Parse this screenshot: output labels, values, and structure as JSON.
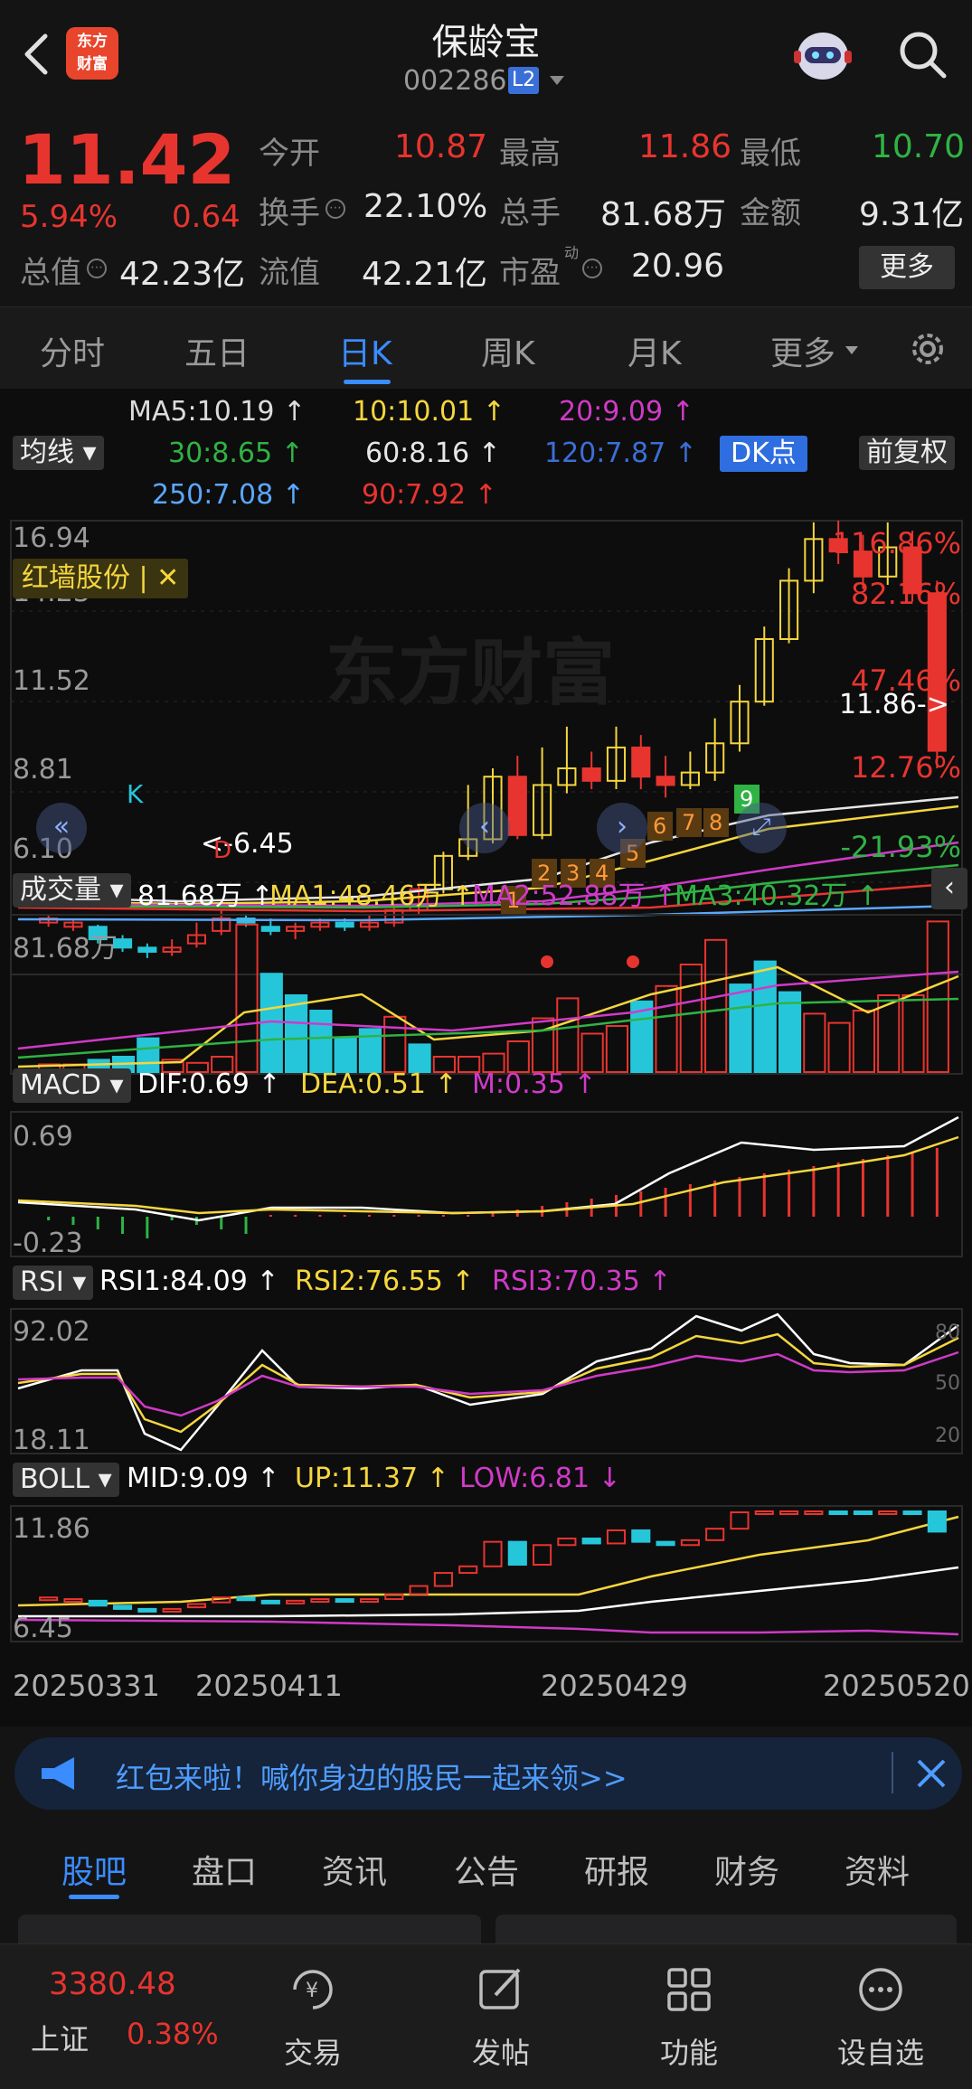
{
  "header": {
    "back_icon": "chevron-left-icon",
    "logo_line1": "东方",
    "logo_line2": "财富",
    "stock_name": "保龄宝",
    "stock_code": "002286",
    "level_badge": "L2",
    "avatar_icon": "robot-avatar-icon",
    "search_icon": "search-icon"
  },
  "quote": {
    "price": "11.42",
    "change_pct": "5.94%",
    "change_amt": "0.64",
    "row1": [
      {
        "label": "今开",
        "value": "10.87",
        "color": "#e8342f"
      },
      {
        "label": "最高",
        "value": "11.86",
        "color": "#e8342f"
      },
      {
        "label": "最低",
        "value": "10.70",
        "color": "#2fb344"
      }
    ],
    "row2": [
      {
        "label": "换手",
        "value": "22.10%"
      },
      {
        "label": "总手",
        "value": "81.68万"
      },
      {
        "label": "金额",
        "value": "9.31亿"
      }
    ],
    "row3": [
      {
        "label": "总值",
        "value": "42.23亿"
      },
      {
        "label": "流值",
        "value": "42.21亿"
      },
      {
        "label": "市盈",
        "value": "20.96"
      }
    ],
    "pe_superscript": "动",
    "more_button": "更多"
  },
  "tabs": [
    "分时",
    "五日",
    "日K",
    "周K",
    "月K",
    "更多"
  ],
  "active_tab": "日K",
  "ma_legend": {
    "button": "均线",
    "items": [
      {
        "text": "MA5:10.19 ↑",
        "color": "#e6e6e6"
      },
      {
        "text": "10:10.01 ↑",
        "color": "#f5d63d"
      },
      {
        "text": "20:9.09 ↑",
        "color": "#d03ac8"
      },
      {
        "text": "30:8.65 ↑",
        "color": "#2fb344"
      },
      {
        "text": "60:8.16 ↑",
        "color": "#e6e6e6"
      },
      {
        "text": "120:7.87 ↑",
        "color": "#3a6fd8"
      },
      {
        "text": "250:7.08 ↑",
        "color": "#5aa8ff"
      },
      {
        "text": "90:7.92 ↑",
        "color": "#e8342f"
      }
    ],
    "dk_button": "DK点",
    "adjust_button": "前复权"
  },
  "kline": {
    "y_labels": [
      "16.94",
      "14.23",
      "11.52",
      "8.81",
      "6.10"
    ],
    "right_pcts": [
      {
        "text": "116.86%",
        "color": "#e8342f"
      },
      {
        "text": "82.16%",
        "color": "#e8342f"
      },
      {
        "text": "47.46%",
        "color": "#e8342f"
      },
      {
        "text": "12.76%",
        "color": "#e8342f"
      },
      {
        "text": "-21.93%",
        "color": "#2fb344"
      }
    ],
    "related_tag": "红墙股份 | ✕",
    "max_marker": "11.86->",
    "min_marker": "<-6.45",
    "k_marker": "K",
    "d_marker": "D",
    "count_labels": [
      "1",
      "2",
      "3",
      "4",
      "5",
      "6",
      "7",
      "8",
      "9"
    ]
  },
  "volume": {
    "button": "成交量",
    "value": "81.68万 ↑",
    "ma1": "MA1:48.46万 ↑",
    "ma2": "MA2:52.88万 ↑",
    "ma3": "MA3:40.32万 ↑",
    "max_label": "81.68万"
  },
  "macd": {
    "button": "MACD",
    "dif": "DIF:0.69 ↑",
    "dea": "DEA:0.51 ↑",
    "m": "M:0.35 ↑",
    "top": "0.69",
    "bottom": "-0.23"
  },
  "rsi": {
    "button": "RSI",
    "rsi1": "RSI1:84.09 ↑",
    "rsi2": "RSI2:76.55 ↑",
    "rsi3": "RSI3:70.35 ↑",
    "top": "92.02",
    "bottom": "18.11",
    "r80": "80",
    "r50": "50",
    "r20": "20"
  },
  "boll": {
    "button": "BOLL",
    "mid": "MID:9.09 ↑",
    "up": "UP:11.37 ↑",
    "low": "LOW:6.81 ↓",
    "top": "11.86",
    "bottom": "6.45"
  },
  "dates": [
    "20250331",
    "20250411",
    "20250429",
    "20250520"
  ],
  "banner": {
    "text": "红包来啦！喊你身边的股民一起来领>>",
    "icon": "megaphone-icon",
    "close_icon": "close-icon"
  },
  "bottom_tabs": [
    "股吧",
    "盘口",
    "资讯",
    "公告",
    "研报",
    "财务",
    "资料"
  ],
  "active_bottom_tab": "股吧",
  "footer": {
    "index_value": "3380.48",
    "index_name": "上证",
    "index_pct": "0.38%",
    "items": [
      {
        "label": "交易",
        "icon": "yuan-exchange-icon"
      },
      {
        "label": "发帖",
        "icon": "edit-post-icon"
      },
      {
        "label": "功能",
        "icon": "grid-apps-icon"
      },
      {
        "label": "设自选",
        "icon": "more-dots-icon"
      }
    ]
  }
}
